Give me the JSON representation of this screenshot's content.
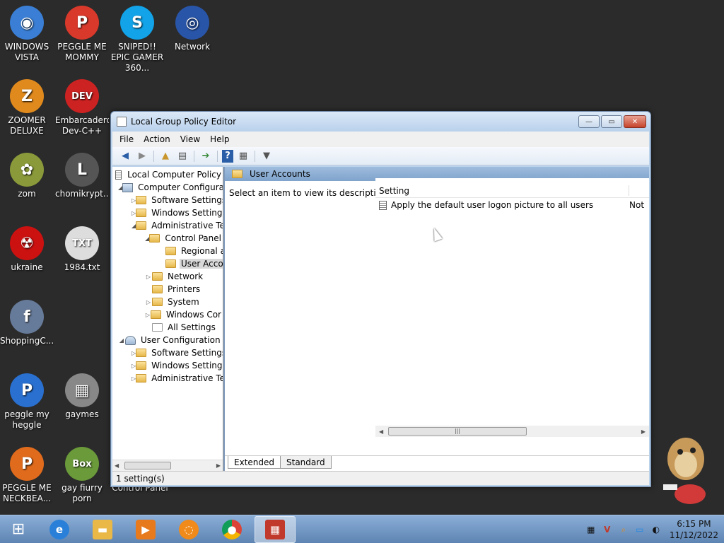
{
  "desktop": {
    "icons": [
      {
        "label": "WINDOWS VISTA",
        "color": "#3a7fd5",
        "glyph": "◉"
      },
      {
        "label": "PEGGLE ME MOMMY",
        "color": "#d9392b",
        "glyph": "P"
      },
      {
        "label": "SNIPED!! EPIC GAMER 360...",
        "color": "#12a3e8",
        "glyph": "S"
      },
      {
        "label": "Network",
        "color": "#2955a8",
        "glyph": "◎"
      },
      {
        "label": "ZOOMER DELUXE",
        "color": "#e08a1e",
        "glyph": "Z"
      },
      {
        "label": "Embarcadero Dev-C++",
        "color": "#cc2222",
        "glyph": "DEV"
      },
      {
        "label": "zom",
        "color": "#8a9a3a",
        "glyph": "✿"
      },
      {
        "label": "chomikrypt...",
        "color": "#555555",
        "glyph": "L"
      },
      {
        "label": "ukraine",
        "color": "#cc1111",
        "glyph": "☢"
      },
      {
        "label": "1984.txt",
        "color": "#dddddd",
        "glyph": "TXT"
      },
      {
        "label": "ShoppingC...",
        "color": "#667a99",
        "glyph": "f"
      },
      {
        "label": "peggle my heggle",
        "color": "#2a70d0",
        "glyph": "P"
      },
      {
        "label": "gaymes",
        "color": "#888888",
        "glyph": "▦"
      },
      {
        "label": "PEGGLE ME NECKBEA...",
        "color": "#e06b1c",
        "glyph": "P"
      },
      {
        "label": "gay fiurry porn",
        "color": "#6a9a3a",
        "glyph": "Box"
      }
    ],
    "hidden_label": "Control Panel"
  },
  "window": {
    "title": "Local Group Policy Editor",
    "controls": {
      "minimize": "—",
      "maximize": "▭",
      "close": "✕"
    },
    "menu": [
      "File",
      "Action",
      "View",
      "Help"
    ],
    "tree": {
      "root": "Local Computer Policy",
      "computer_config": "Computer Configura",
      "cc_software": "Software Settings",
      "cc_windows": "Windows Setting",
      "cc_admin": "Administrative Te",
      "control_panel": "Control Panel",
      "regional": "Regional a",
      "user_accounts": "User Acco",
      "network": "Network",
      "printers": "Printers",
      "system": "System",
      "windows_components": "Windows Cor",
      "all_settings": "All Settings",
      "user_config": "User Configuration",
      "uc_software": "Software Settings",
      "uc_windows": "Windows Setting",
      "uc_admin": "Administrative Te"
    },
    "main": {
      "header": "User Accounts",
      "description": "Select an item to view its description.",
      "column_setting": "Setting",
      "rows": [
        {
          "name": "Apply the default user logon picture to all users",
          "state": "Not"
        }
      ],
      "tab_extended": "Extended",
      "tab_standard": "Standard"
    },
    "status": "1 setting(s)"
  },
  "taskbar": {
    "time": "6:15 PM",
    "date": "11/12/2022"
  }
}
